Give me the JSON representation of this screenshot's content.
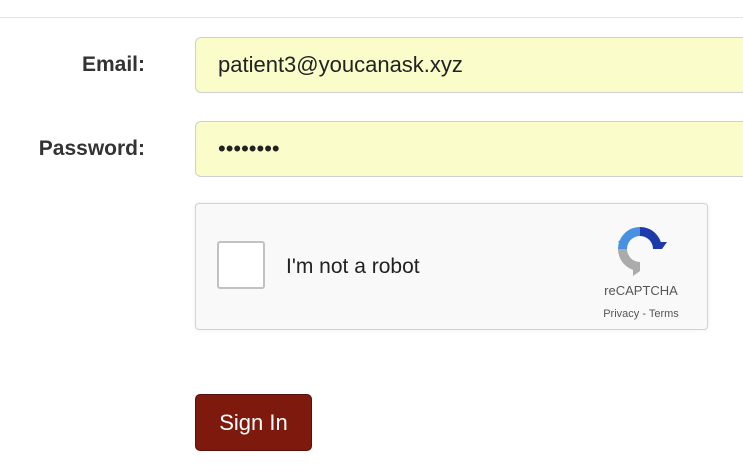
{
  "form": {
    "email_label": "Email:",
    "email_value": "patient3@youcanask.xyz",
    "password_label": "Password:",
    "password_value": "••••••••",
    "field_bg_color": "#fafdc9"
  },
  "captcha": {
    "checkbox_checked": false,
    "label": "I'm not a robot",
    "brand": "reCAPTCHA",
    "privacy_link": "Privacy",
    "separator": " - ",
    "terms_link": "Terms",
    "logo_icon": "recaptcha-logo-icon"
  },
  "signin": {
    "label": "Sign In",
    "color": "#7d1a0d"
  }
}
